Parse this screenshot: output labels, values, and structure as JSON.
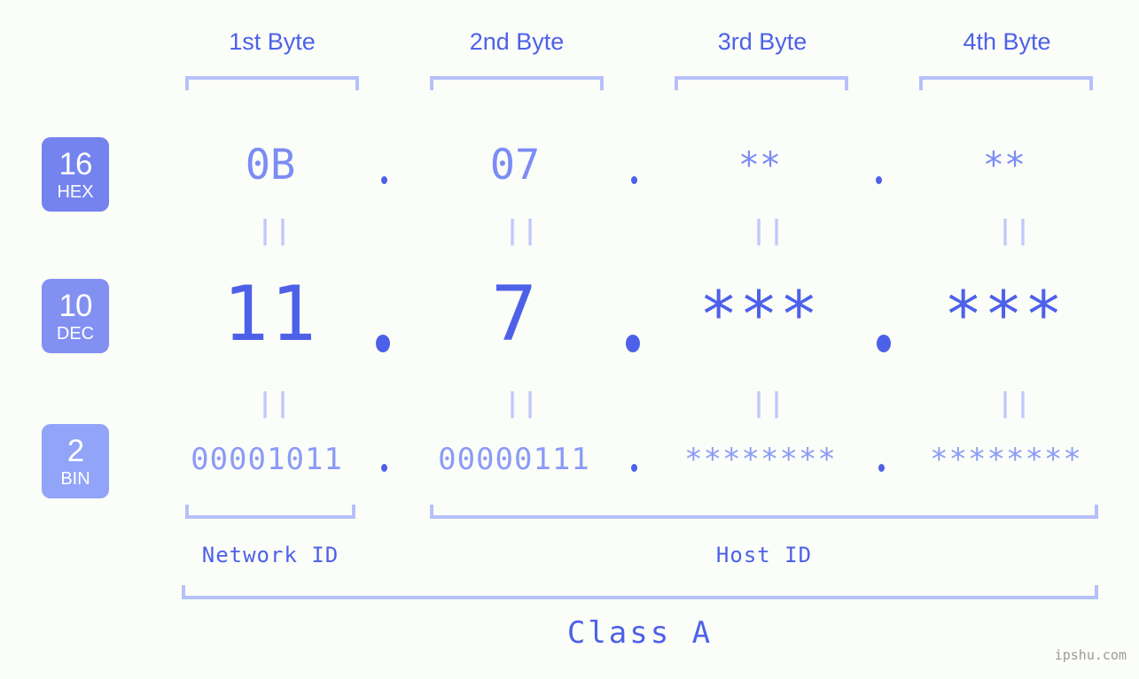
{
  "meta": {
    "background_color": "#fbfdf8",
    "accent_strong": "#4d61e8",
    "accent_mid": "#7b8cf5",
    "accent_light": "#b6c0fb",
    "watermark": "ipshu.com"
  },
  "byte_headers": [
    {
      "label": "1st Byte"
    },
    {
      "label": "2nd Byte"
    },
    {
      "label": "3rd Byte"
    },
    {
      "label": "4th Byte"
    }
  ],
  "bases": [
    {
      "num": "16",
      "name": "HEX",
      "color": "#7483ee"
    },
    {
      "num": "10",
      "name": "DEC",
      "color": "#8290f2"
    },
    {
      "num": "2",
      "name": "BIN",
      "color": "#91a4f7"
    }
  ],
  "rows": {
    "hex": {
      "base_num": "16",
      "base_name": "HEX",
      "values": [
        "0B",
        "07",
        "**",
        "**"
      ],
      "separator": "."
    },
    "dec": {
      "base_num": "10",
      "base_name": "DEC",
      "values": [
        "11",
        "7",
        "***",
        "***"
      ],
      "separator": "."
    },
    "bin": {
      "base_num": "2",
      "base_name": "BIN",
      "values": [
        "00001011",
        "00000111",
        "********",
        "********"
      ],
      "separator": "."
    }
  },
  "equals_marks": {
    "glyph": "||",
    "count_per_gap": 4,
    "gaps": 2
  },
  "id_labels": {
    "network": "Network ID",
    "host": "Host ID"
  },
  "class_label": "Class A"
}
